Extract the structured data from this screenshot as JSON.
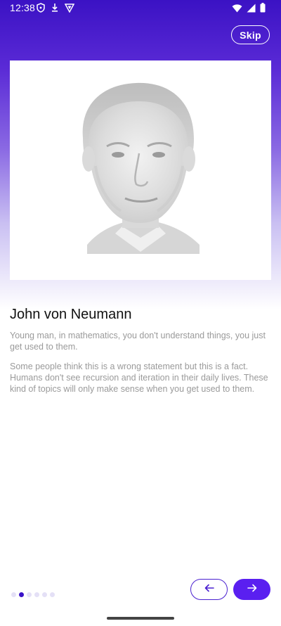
{
  "status_bar": {
    "time": "12:38",
    "left_icons": [
      "shield-icon",
      "download-icon",
      "vpn-icon"
    ],
    "right_icons": [
      "wifi-icon",
      "signal-icon",
      "battery-icon"
    ]
  },
  "header": {
    "skip_label": "Skip"
  },
  "slide": {
    "image_icon": "portrait-image",
    "title": "John von Neumann",
    "paragraph1": "Young man, in mathematics, you don't understand things, you just get used to them.",
    "paragraph2": "Some people think this is a wrong statement but this is a fact. Humans don't see recursion and iteration in their daily lives. These kind of topics will only make sense when you get used to them."
  },
  "pager": {
    "total": 6,
    "active_index": 1
  },
  "navigation": {
    "prev_icon": "arrow-left-icon",
    "next_icon": "arrow-right-icon"
  },
  "colors": {
    "accent": "#5a1ff0",
    "gradient_top": "#3b12c4",
    "text_primary": "#111111",
    "text_secondary": "#9a9a9a"
  }
}
